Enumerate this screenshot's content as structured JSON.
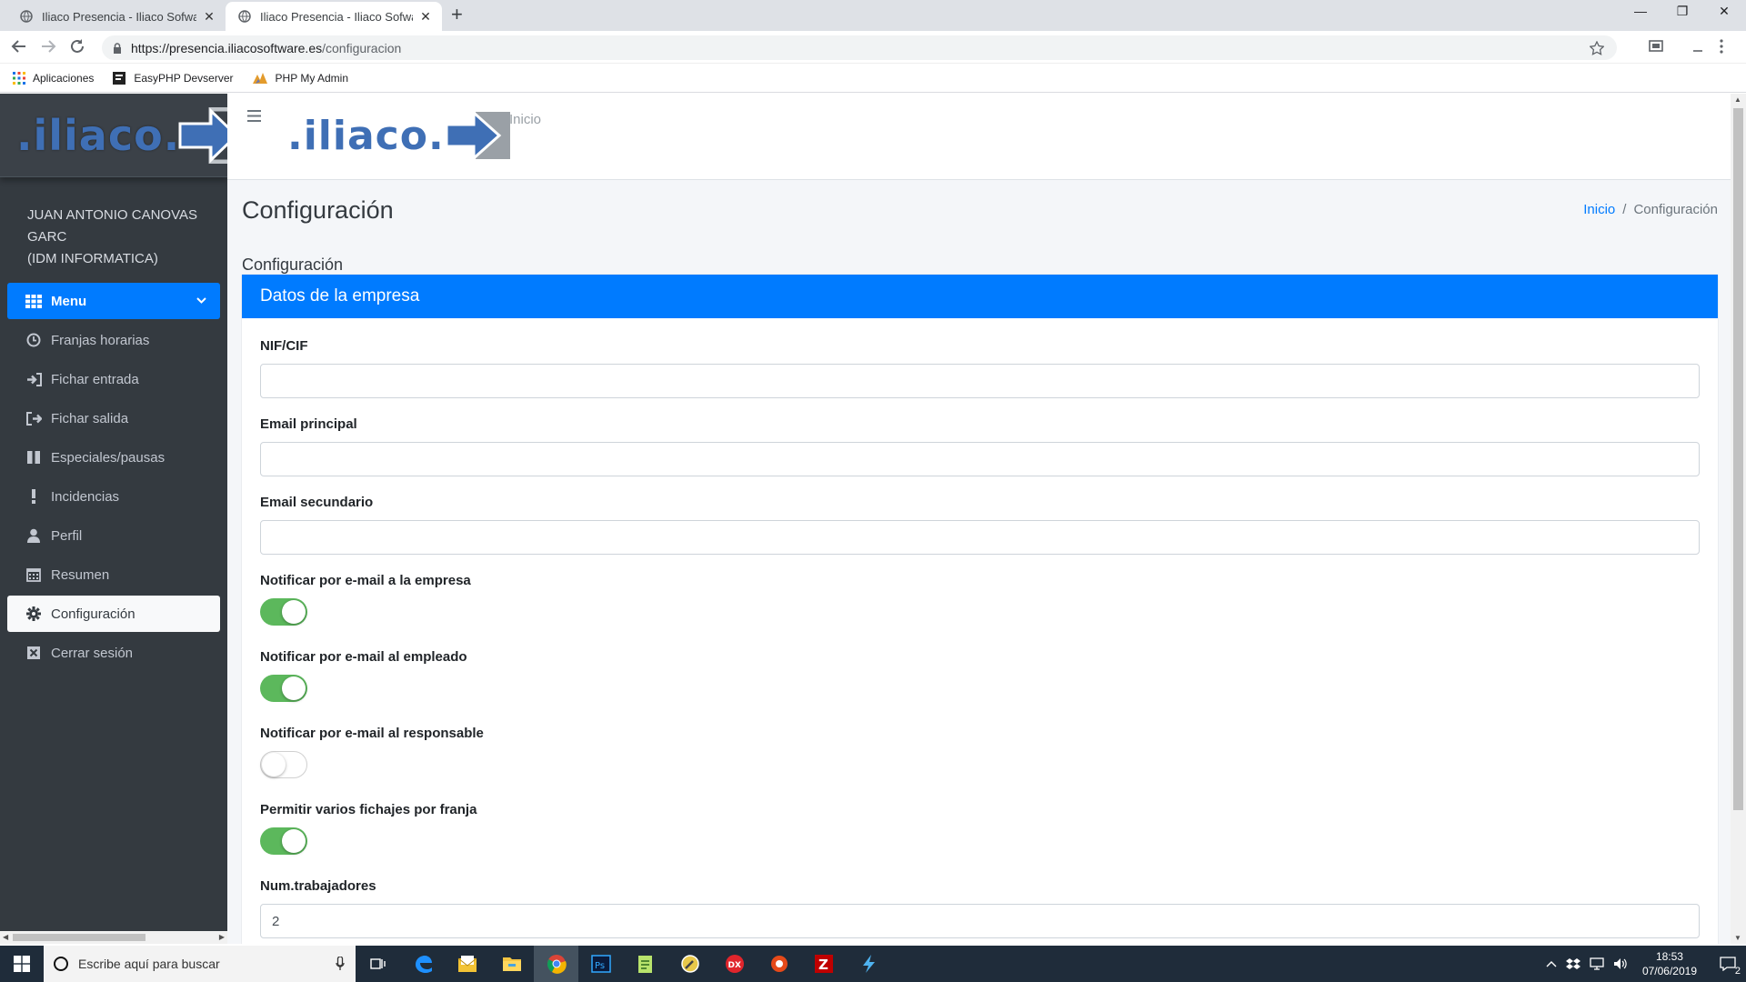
{
  "browser": {
    "tabs": [
      {
        "title": "Iliaco Presencia - Iliaco Sofware c",
        "close": "✕"
      },
      {
        "title": "Iliaco Presencia - Iliaco Sofware c",
        "close": "✕"
      }
    ],
    "new_tab": "+",
    "window_controls": {
      "minimize": "—",
      "maximize": "❐",
      "close": "✕"
    },
    "url_host": "https://presencia.iliacosoftware.es",
    "url_path": "/configuracion",
    "bookmarks": [
      {
        "label": "Aplicaciones",
        "icon": "apps-grid-icon"
      },
      {
        "label": "EasyPHP Devserver",
        "icon": "easyphp-icon"
      },
      {
        "label": "PHP My Admin",
        "icon": "phpmyadmin-icon"
      }
    ]
  },
  "sidebar": {
    "brand": ".iliaco.",
    "user_name": "JUAN ANTONIO CANOVAS GARC",
    "user_company": "(IDM INFORMATICA)",
    "menu_header": "Menu",
    "items": [
      {
        "label": "Franjas horarias",
        "icon": "clock-icon"
      },
      {
        "label": "Fichar entrada",
        "icon": "sign-in-icon"
      },
      {
        "label": "Fichar salida",
        "icon": "sign-out-icon"
      },
      {
        "label": "Especiales/pausas",
        "icon": "pause-icon"
      },
      {
        "label": "Incidencias",
        "icon": "exclamation-icon"
      },
      {
        "label": "Perfil",
        "icon": "user-icon"
      },
      {
        "label": "Resumen",
        "icon": "calendar-icon"
      },
      {
        "label": "Configuración",
        "icon": "gear-icon",
        "active": true
      },
      {
        "label": "Cerrar sesión",
        "icon": "close-box-icon"
      }
    ]
  },
  "topnav": {
    "logo_text": ".iliaco.",
    "inicio": "Inicio"
  },
  "content": {
    "page_title": "Configuración",
    "breadcrumb": {
      "home": "Inicio",
      "separator": "/",
      "current": "Configuración"
    },
    "section_title": "Configuración",
    "card_title": "Datos de la empresa",
    "fields": {
      "nif": {
        "label": "NIF/CIF",
        "value": ""
      },
      "email_principal": {
        "label": "Email principal",
        "value": ""
      },
      "email_secundario": {
        "label": "Email secundario",
        "value": ""
      },
      "notif_empresa": {
        "label": "Notificar por e-mail a la empresa",
        "on": true
      },
      "notif_empleado": {
        "label": "Notificar por e-mail al empleado",
        "on": true
      },
      "notif_responsable": {
        "label": "Notificar por e-mail al responsable",
        "on": false
      },
      "varios_fichajes": {
        "label": "Permitir varios fichajes por franja",
        "on": true
      },
      "num_trabajadores": {
        "label": "Num.trabajadores",
        "value": "2"
      }
    }
  },
  "taskbar": {
    "search_placeholder": "Escribe aquí para buscar",
    "time": "18:53",
    "date": "07/06/2019",
    "notifications": "2"
  },
  "colors": {
    "sidebar_bg": "#343a40",
    "primary": "#007bff",
    "switch_on": "#5cb85c",
    "content_bg": "#f4f6f9"
  }
}
